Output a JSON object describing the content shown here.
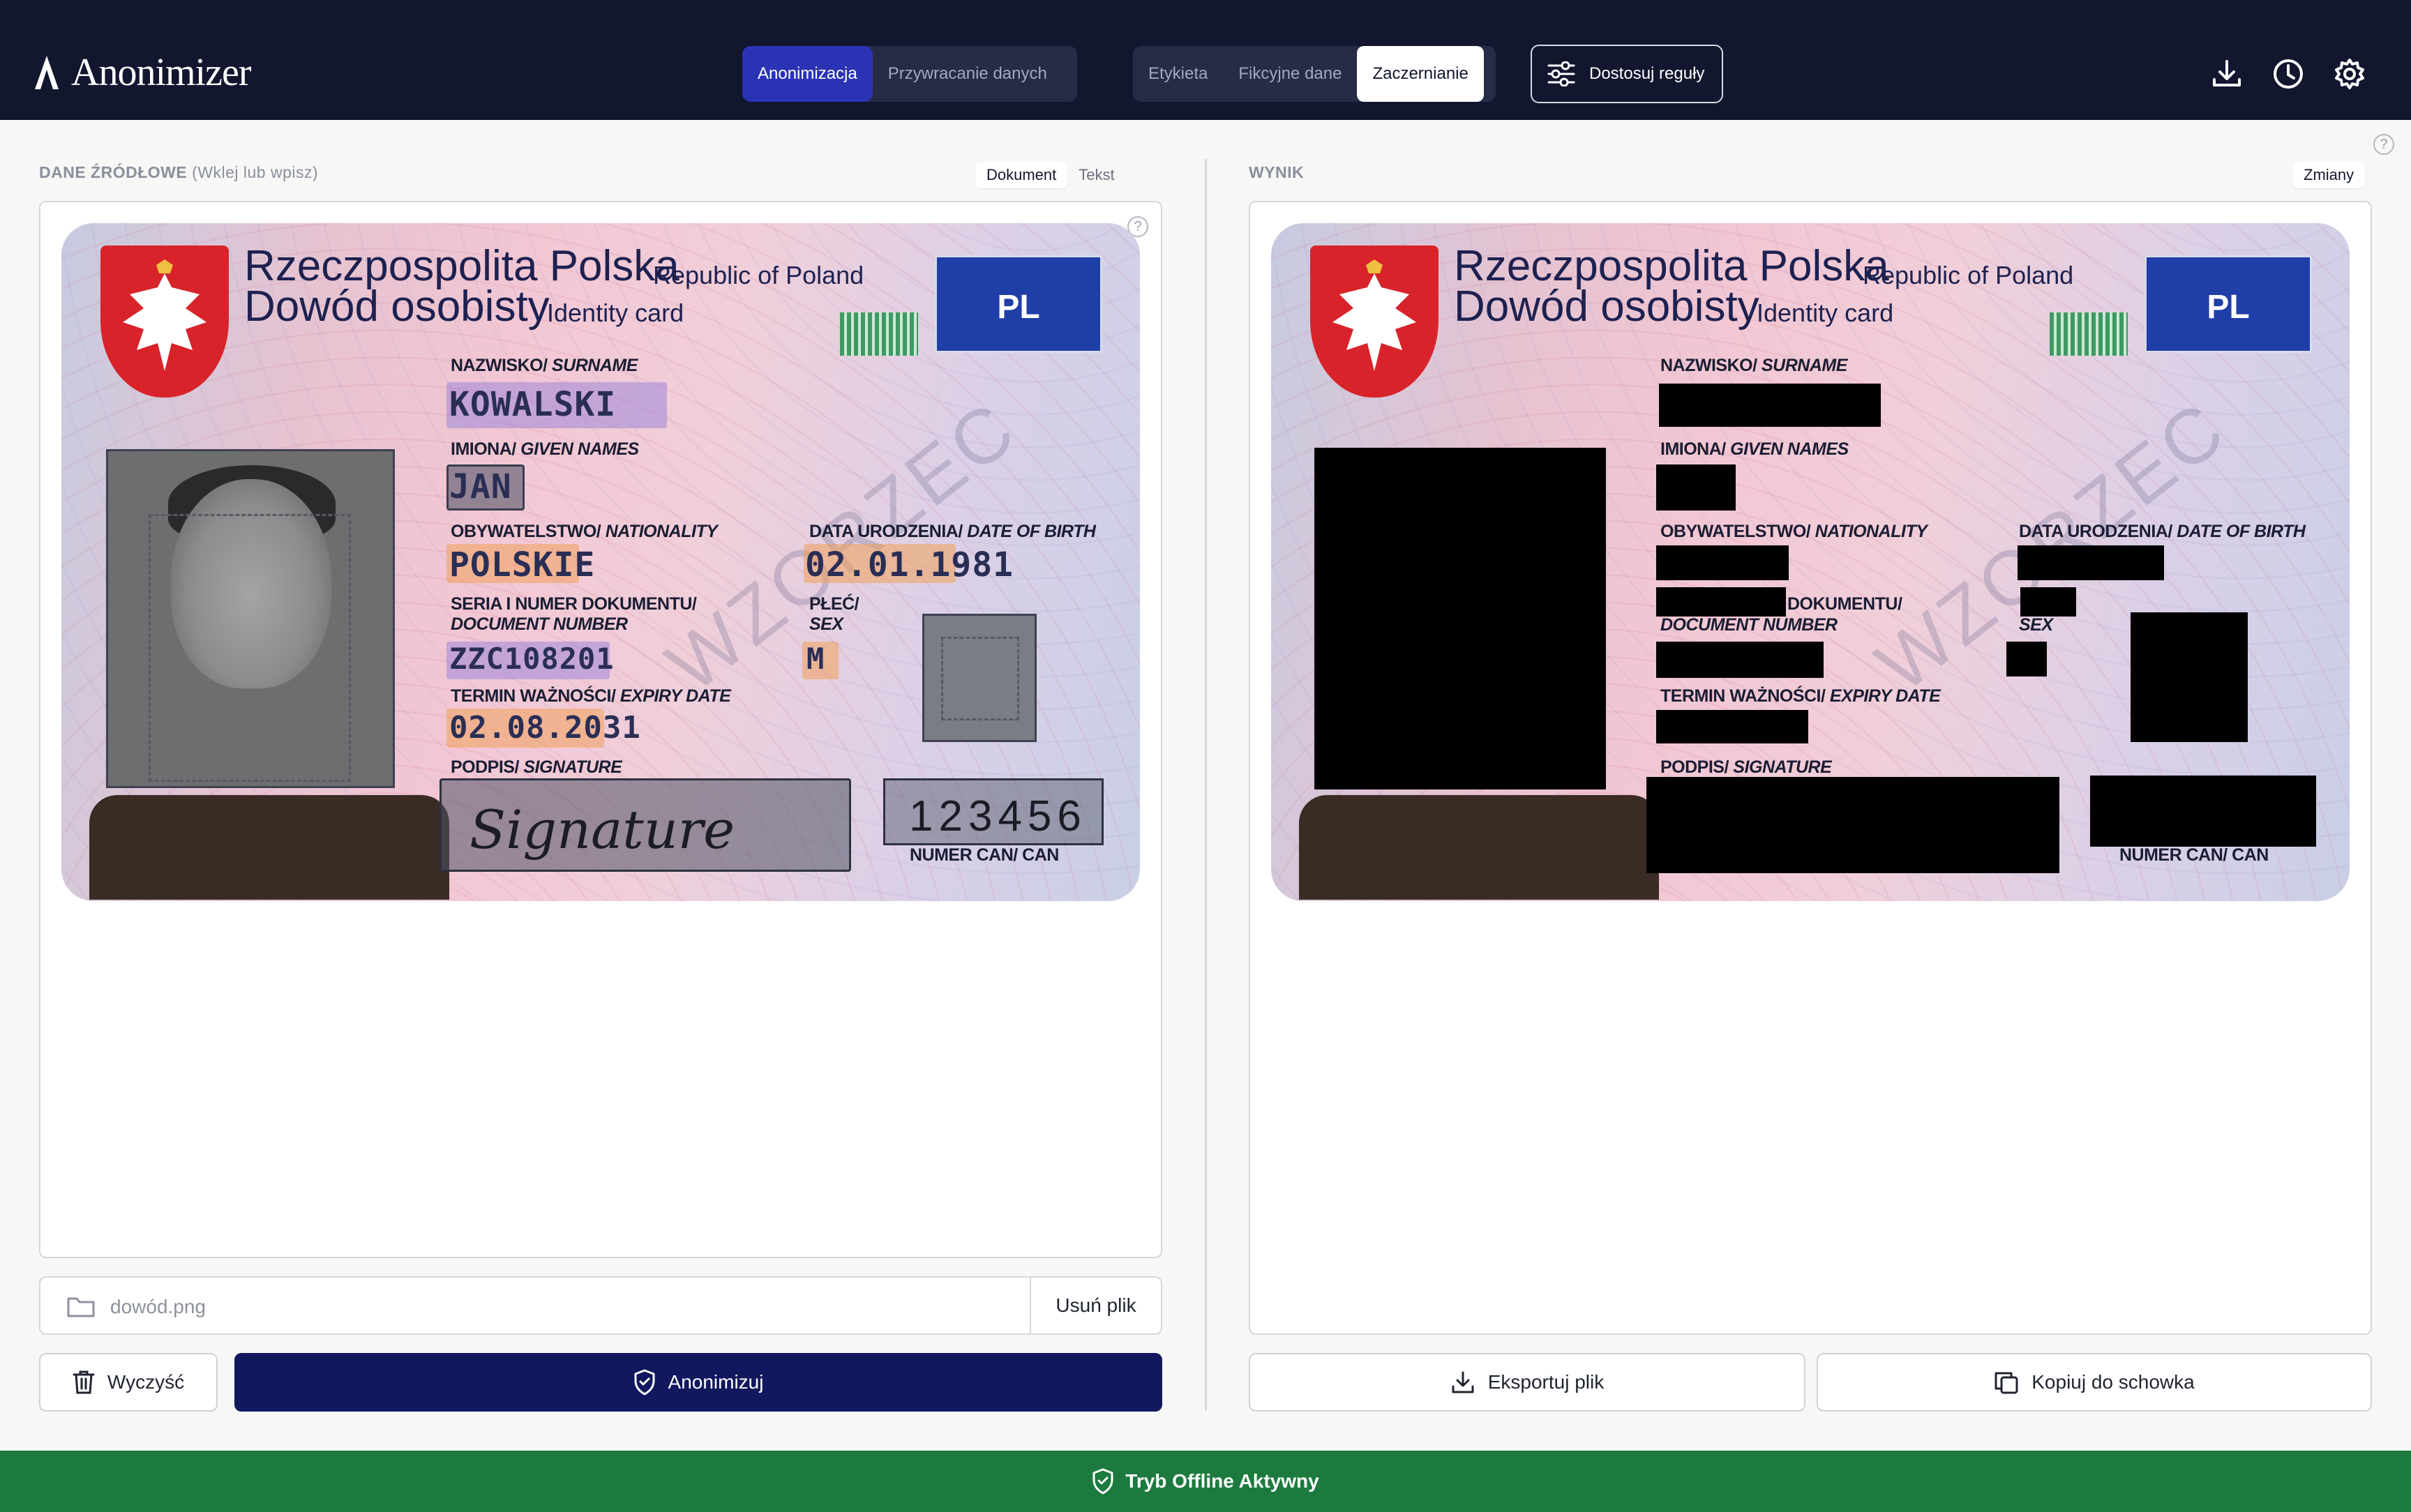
{
  "app": {
    "name": "Anonimizer"
  },
  "header": {
    "mode_tabs": [
      {
        "label": "Anonimizacja",
        "active": true
      },
      {
        "label": "Przywracanie danych",
        "active": false
      }
    ],
    "style_tabs": [
      {
        "label": "Etykieta",
        "active": false
      },
      {
        "label": "Fikcyjne dane",
        "active": false
      },
      {
        "label": "Zaczernianie",
        "active": true
      }
    ],
    "rules_button": "Dostosuj reguły",
    "icons": [
      "download-icon",
      "history-icon",
      "settings-icon"
    ]
  },
  "source_panel": {
    "title": "DANE ŹRÓDŁOWE",
    "hint": "(Wklej lub wpisz)",
    "view_tabs": [
      {
        "label": "Dokument",
        "active": true
      },
      {
        "label": "Tekst",
        "active": false
      }
    ],
    "file_name": "dowód.png",
    "remove_file": "Usuń plik",
    "clear_button": "Wyczyść",
    "anonymize_button": "Anonimizuj"
  },
  "result_panel": {
    "title": "WYNIK",
    "changes_tab": "Zmiany",
    "export_button": "Eksportuj plik",
    "copy_button": "Kopiuj do schowka"
  },
  "id_card": {
    "country_pl": "Rzeczpospolita Polska",
    "country_en": "Republic of Poland",
    "doc_pl": "Dowód osobisty",
    "doc_en": "Identity card",
    "eu_code": "PL",
    "watermark": "WZORZEC",
    "surname_label_pl": "NAZWISKO/",
    "surname_label_en": "SURNAME",
    "surname": "KOWALSKI",
    "names_label_pl": "IMIONA/",
    "names_label_en": "GIVEN NAMES",
    "given_names": "JAN",
    "nationality_label_pl": "OBYWATELSTWO/",
    "nationality_label_en": "NATIONALITY",
    "nationality": "POLSKIE",
    "dob_label_pl": "DATA URODZENIA/",
    "dob_label_en": "DATE OF BIRTH",
    "dob": "02.01.1981",
    "docnum_label_pl": "SERIA I NUMER DOKUMENTU/",
    "docnum_label_pl_short": "DOKUMENTU/",
    "docnum_label_en": "DOCUMENT NUMBER",
    "doc_number": "ZZC108201",
    "sex_label_pl": "PŁEĆ/",
    "sex_label_en": "SEX",
    "sex": "M",
    "expiry_label_pl": "TERMIN WAŻNOŚCI/",
    "expiry_label_en": "EXPIRY DATE",
    "expiry": "02.08.2031",
    "signature_label_pl": "PODPIS/",
    "signature_label_en": "SIGNATURE",
    "signature": "Signature",
    "can_label": "NUMER CAN/ CAN",
    "can": "123456"
  },
  "footer": {
    "status": "Tryb Offline Aktywny"
  },
  "colors": {
    "header_bg": "#12162e",
    "accent": "#2b33b5",
    "primary_button": "#12185e",
    "footer_bg": "#1c7a3e"
  }
}
